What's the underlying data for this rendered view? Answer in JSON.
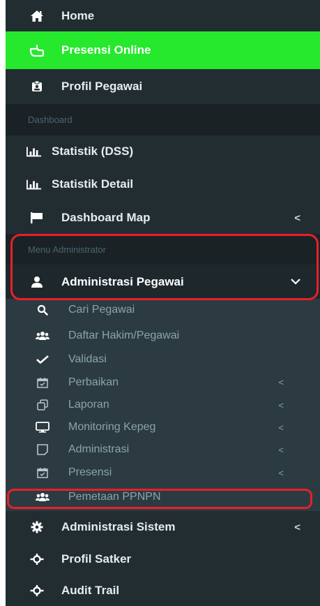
{
  "menu": {
    "home": "Home",
    "presensi_online": "Presensi Online",
    "profil_pegawai": "Profil Pegawai",
    "dashboard_header": "Dashboard",
    "statistik_dss": "Statistik (DSS)",
    "statistik_detail": "Statistik Detail",
    "dashboard_map": "Dashboard Map",
    "admin_header": "Menu Administrator",
    "administrasi_pegawai": "Administrasi Pegawai",
    "administrasi_sistem": "Administrasi Sistem",
    "profil_satker": "Profil Satker",
    "audit_trail": "Audit Trail"
  },
  "submenu": {
    "cari_pegawai": "Cari Pegawai",
    "daftar_hakim": "Daftar Hakim/Pegawai",
    "validasi": "Validasi",
    "perbaikan": "Perbaikan",
    "laporan": "Laporan",
    "monitoring_kepeg": "Monitoring Kepeg",
    "administrasi": "Administrasi",
    "presensi": "Presensi",
    "pemetaan_ppnpn": "Pemetaan PPNPN"
  },
  "colors": {
    "sidebar_bg": "#222d32",
    "active_green": "#26e82d",
    "highlight_red": "#e8202a"
  },
  "icons": {
    "home": "home-icon",
    "presensi_online": "hand-pointer-icon",
    "profil_pegawai": "id-card-icon",
    "statistik": "bar-chart-icon",
    "dashboard_map": "flag-icon",
    "administrasi_pegawai": "user-icon",
    "administrasi_sistem": "gear-icon",
    "profil_satker": "crosshair-icon",
    "audit_trail": "crosshair-icon"
  }
}
